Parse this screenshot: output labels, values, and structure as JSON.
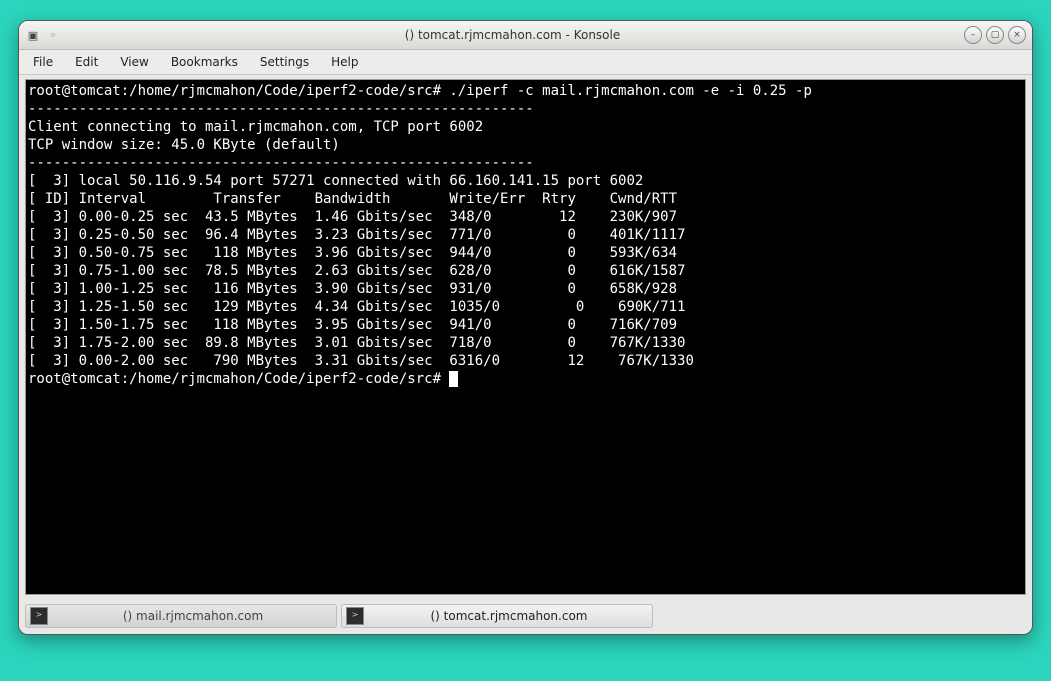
{
  "window": {
    "title": "() tomcat.rjmcmahon.com - Konsole"
  },
  "menubar": [
    "File",
    "Edit",
    "View",
    "Bookmarks",
    "Settings",
    "Help"
  ],
  "tabs": [
    {
      "label": "() mail.rjmcmahon.com",
      "active": false
    },
    {
      "label": "() tomcat.rjmcmahon.com",
      "active": true
    }
  ],
  "terminal": {
    "prompt1": "root@tomcat:/home/rjmcmahon/Code/iperf2-code/src# ./iperf -c mail.rjmcmahon.com -e -i 0.25 -p ",
    "dashes1": "------------------------------------------------------------",
    "connect": "Client connecting to mail.rjmcmahon.com, TCP port 6002",
    "winsize": "TCP window size: 45.0 KByte (default)",
    "dashes2": "------------------------------------------------------------",
    "local": "[  3] local 50.116.9.54 port 57271 connected with 66.160.141.15 port 6002",
    "header": "[ ID] Interval        Transfer    Bandwidth       Write/Err  Rtry    Cwnd/RTT",
    "rows": [
      "[  3] 0.00-0.25 sec  43.5 MBytes  1.46 Gbits/sec  348/0        12    230K/907",
      "[  3] 0.25-0.50 sec  96.4 MBytes  3.23 Gbits/sec  771/0         0    401K/1117",
      "[  3] 0.50-0.75 sec   118 MBytes  3.96 Gbits/sec  944/0         0    593K/634",
      "[  3] 0.75-1.00 sec  78.5 MBytes  2.63 Gbits/sec  628/0         0    616K/1587",
      "[  3] 1.00-1.25 sec   116 MBytes  3.90 Gbits/sec  931/0         0    658K/928",
      "[  3] 1.25-1.50 sec   129 MBytes  4.34 Gbits/sec  1035/0         0    690K/711",
      "[  3] 1.50-1.75 sec   118 MBytes  3.95 Gbits/sec  941/0         0    716K/709",
      "[  3] 1.75-2.00 sec  89.8 MBytes  3.01 Gbits/sec  718/0         0    767K/1330",
      "[  3] 0.00-2.00 sec   790 MBytes  3.31 Gbits/sec  6316/0        12    767K/1330"
    ],
    "prompt2": "root@tomcat:/home/rjmcmahon/Code/iperf2-code/src# "
  }
}
